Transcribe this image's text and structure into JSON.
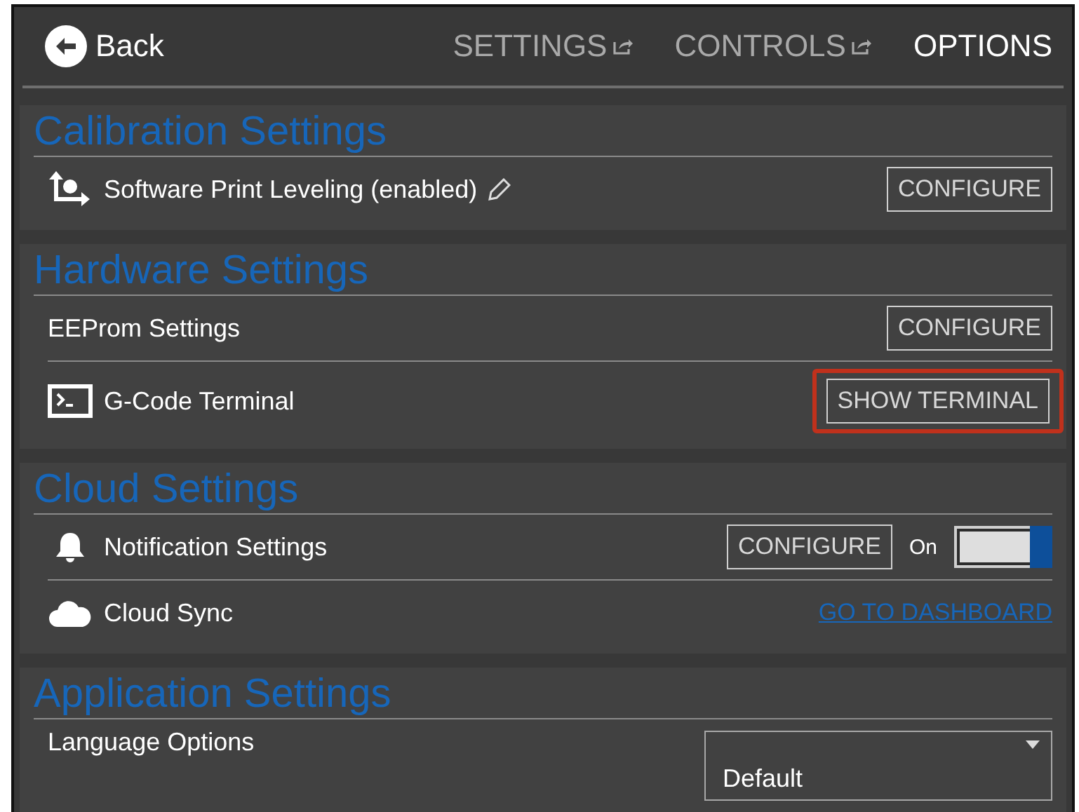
{
  "header": {
    "back": "Back",
    "tabs": [
      {
        "label": "SETTINGS",
        "selected": false,
        "external": true
      },
      {
        "label": "CONTROLS",
        "selected": false,
        "external": true
      },
      {
        "label": "OPTIONS",
        "selected": true,
        "external": false
      }
    ]
  },
  "sections": [
    {
      "title": "Calibration Settings",
      "rows": [
        {
          "kind": "button",
          "label": "Software Print Leveling (enabled)",
          "editable": true,
          "button": "CONFIGURE",
          "highlighted": false
        }
      ]
    },
    {
      "title": "Hardware Settings",
      "rows": [
        {
          "kind": "button",
          "label": "EEProm Settings",
          "button": "CONFIGURE",
          "highlighted": false
        },
        {
          "kind": "button",
          "label": "G-Code Terminal",
          "button": "SHOW TERMINAL",
          "highlighted": true
        }
      ]
    },
    {
      "title": "Cloud Settings",
      "rows": [
        {
          "kind": "toggle",
          "label": "Notification Settings",
          "button": "CONFIGURE",
          "toggle_label": "On",
          "on": true
        },
        {
          "kind": "link",
          "label": "Cloud Sync",
          "link": "GO TO DASHBOARD"
        }
      ]
    },
    {
      "title": "Application Settings",
      "rows": [
        {
          "kind": "select",
          "label": "Language Options",
          "value": "Default"
        }
      ]
    }
  ]
}
